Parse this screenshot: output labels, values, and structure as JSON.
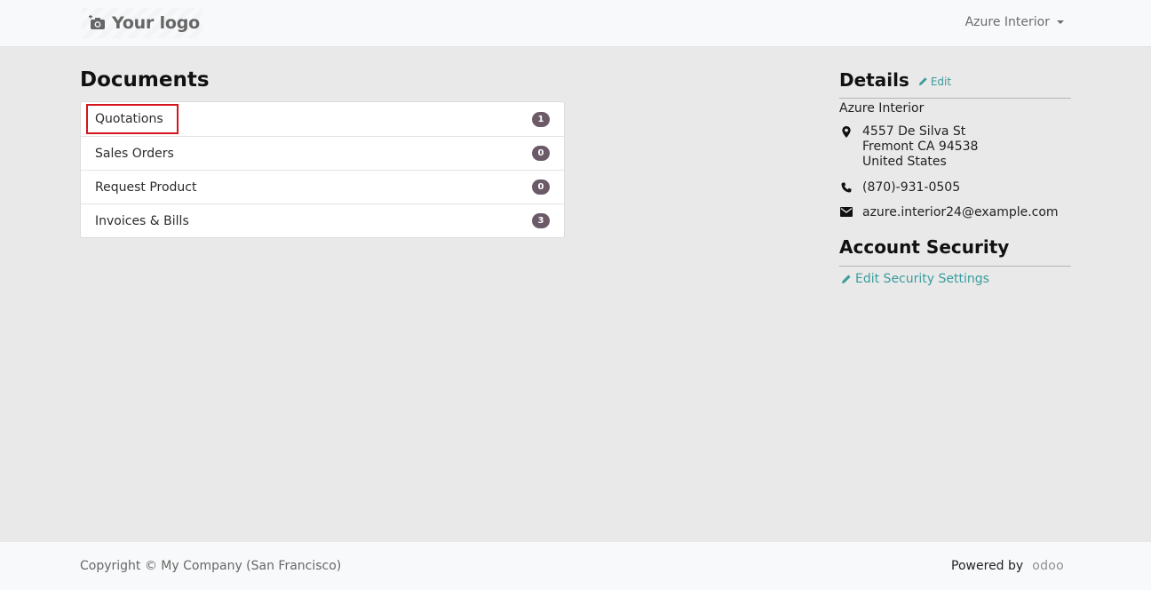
{
  "header": {
    "logo_text": "Your logo",
    "user_menu_label": "Azure Interior"
  },
  "documents": {
    "title": "Documents",
    "items": [
      {
        "label": "Quotations",
        "count": "1"
      },
      {
        "label": "Sales Orders",
        "count": "0"
      },
      {
        "label": "Request Product",
        "count": "0"
      },
      {
        "label": "Invoices & Bills",
        "count": "3"
      }
    ]
  },
  "details": {
    "title": "Details",
    "edit_label": "Edit",
    "company": "Azure Interior",
    "address_line1": "4557 De Silva St",
    "address_line2": "Fremont CA 94538",
    "address_line3": "United States",
    "phone": "(870)-931-0505",
    "email": "azure.interior24@example.com"
  },
  "security": {
    "title": "Account Security",
    "link_label": "Edit Security Settings"
  },
  "footer": {
    "copyright": "Copyright © My Company (San Francisco)",
    "powered_by": "Powered by",
    "odoo_logo": "odoo"
  },
  "colors": {
    "accent": "#3a9c9c",
    "badge": "#6b5a68",
    "highlight": "#d4151c"
  },
  "icons": {
    "logo": "camera-icon",
    "address": "map-marker-icon",
    "phone": "phone-icon",
    "email": "envelope-icon",
    "edit": "pencil-icon"
  }
}
